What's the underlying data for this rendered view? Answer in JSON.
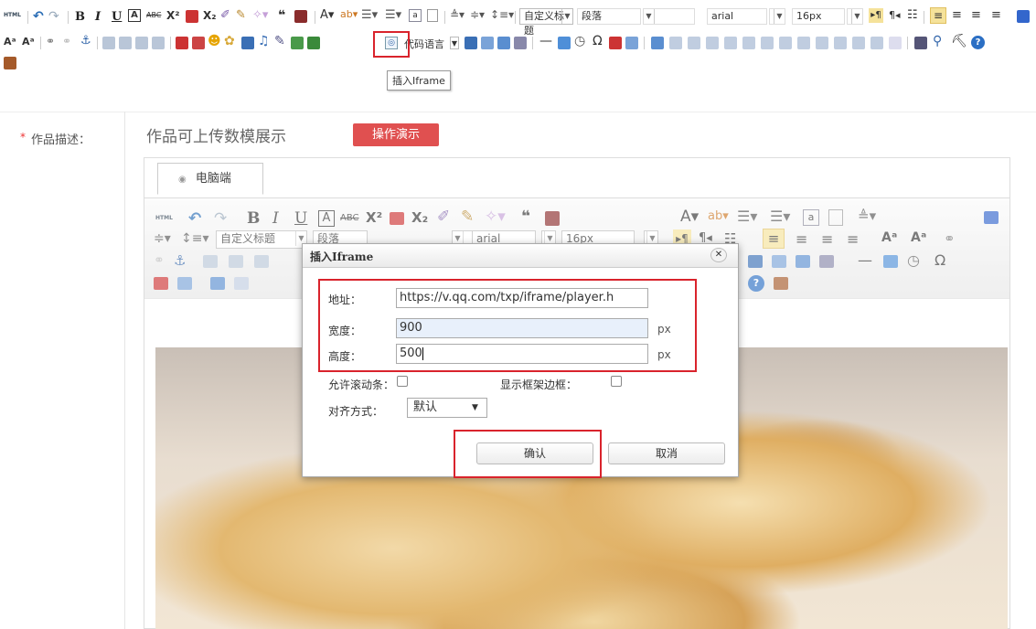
{
  "toolbar": {
    "html_label": "HTML",
    "bold": "B",
    "italic": "I",
    "underline": "U",
    "heading_combo": "自定义标题",
    "paragraph_combo": "段落",
    "font_combo": "arial",
    "size_combo": "16px",
    "code_lang": "代码语言",
    "tooltip": "插入Iframe"
  },
  "form": {
    "required_star": "*",
    "field_label": "作品描述：",
    "hint": "作品可上传数模展示",
    "demo_button": "操作演示",
    "tab_label": "电脑端"
  },
  "inner_toolbar": {
    "html_label": "HTML",
    "heading_combo": "自定义标题",
    "paragraph_combo": "段落",
    "font_combo": "arial",
    "size_combo": "16px"
  },
  "dialog": {
    "title": "插入Iframe",
    "address_label": "地址：",
    "address_value": "https://v.qq.com/txp/iframe/player.h",
    "width_label": "宽度：",
    "width_value": "900",
    "width_unit": "px",
    "height_label": "高度：",
    "height_value": "500",
    "height_unit": "px",
    "scroll_label": "允许滚动条：",
    "border_label": "显示框架边框：",
    "align_label": "对齐方式：",
    "align_value": "默认",
    "ok_label": "确认",
    "cancel_label": "取消"
  },
  "colors": {
    "highlight": "#d9232c",
    "demo_button": "#e05050"
  }
}
